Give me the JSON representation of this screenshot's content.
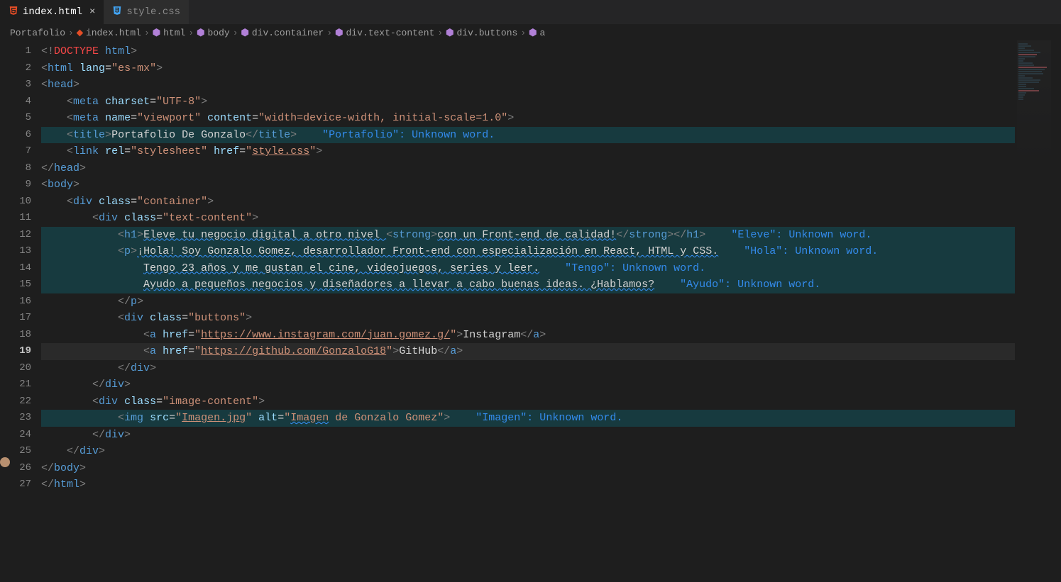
{
  "tabs": [
    {
      "name": "index.html",
      "active": true,
      "iconColor": "#e44d26"
    },
    {
      "name": "style.css",
      "active": false,
      "iconColor": "#42a5f5"
    }
  ],
  "breadcrumb": [
    {
      "text": "Portafolio",
      "icon": ""
    },
    {
      "text": "index.html",
      "icon": "html"
    },
    {
      "text": "html",
      "icon": "cube"
    },
    {
      "text": "body",
      "icon": "cube"
    },
    {
      "text": "div.container",
      "icon": "cube"
    },
    {
      "text": "div.text-content",
      "icon": "cube"
    },
    {
      "text": "div.buttons",
      "icon": "cube"
    },
    {
      "text": "a",
      "icon": "cube"
    }
  ],
  "lineCount": 27,
  "currentLine": 19,
  "highlightedLines": [
    6,
    12,
    13,
    14,
    15,
    23
  ],
  "hints": {
    "l6": "\"Portafolio\": Unknown word.",
    "l12": "\"Eleve\": Unknown word.",
    "l13": "\"Hola\": Unknown word.",
    "l14": "\"Tengo\": Unknown word.",
    "l15": "\"Ayudo\": Unknown word.",
    "l23": "\"Imagen\": Unknown word."
  },
  "code": {
    "l1": {
      "doctype": "DOCTYPE",
      "html": "html"
    },
    "l2": {
      "tag": "html",
      "attr": "lang",
      "val": "\"es-mx\""
    },
    "l3": {
      "tag": "head"
    },
    "l4": {
      "tag": "meta",
      "a1": "charset",
      "v1": "\"UTF-8\""
    },
    "l5": {
      "tag": "meta",
      "a1": "name",
      "v1": "\"viewport\"",
      "a2": "content",
      "v2": "\"width=device-width, initial-scale=1.0\""
    },
    "l6": {
      "tag": "title",
      "text": "Portafolio De Gonzalo"
    },
    "l7": {
      "tag": "link",
      "a1": "rel",
      "v1": "\"stylesheet\"",
      "a2": "href",
      "v2": "\"style.css\"",
      "linkText": "style.css"
    },
    "l8": {
      "tag": "head"
    },
    "l9": {
      "tag": "body"
    },
    "l10": {
      "tag": "div",
      "a1": "class",
      "v1": "\"container\""
    },
    "l11": {
      "tag": "div",
      "a1": "class",
      "v1": "\"text-content\""
    },
    "l12": {
      "tag": "h1",
      "t1": "Eleve tu negocio digital a otro nivel ",
      "strong": "strong",
      "t2": "con un Front-end de calidad!"
    },
    "l13": {
      "tag": "p",
      "t1": "¡Hola! Soy Gonzalo Gomez, desarrollador Front-end con especialización en React, HTML y CSS."
    },
    "l14": {
      "t1": "Tengo 23 años y me gustan el cine, videojuegos, series y leer."
    },
    "l15": {
      "t1": "Ayudo a pequeños negocios y diseñadores a llevar a cabo buenas ideas. ¿Hablamos?"
    },
    "l16": {
      "tag": "p"
    },
    "l17": {
      "tag": "div",
      "a1": "class",
      "v1": "\"buttons\""
    },
    "l18": {
      "tag": "a",
      "a1": "href",
      "v1": "\"https://www.instagram.com/juan.gomez.g/\"",
      "linkText": "https://www.instagram.com/juan.gomez.g/",
      "text": "Instagram"
    },
    "l19": {
      "tag": "a",
      "a1": "href",
      "v1": "\"https://github.com/GonzaloG18\"",
      "linkText": "https://github.com/GonzaloG18",
      "text": "GitHub"
    },
    "l20": {
      "tag": "div"
    },
    "l21": {
      "tag": "div"
    },
    "l22": {
      "tag": "div",
      "a1": "class",
      "v1": "\"image-content\""
    },
    "l23": {
      "tag": "img",
      "a1": "src",
      "v1": "\"Imagen.jpg\"",
      "linkText": "Imagen.jpg",
      "a2": "alt",
      "v2a": "Imagen",
      "v2b": " de Gonzalo Gomez"
    },
    "l24": {
      "tag": "div"
    },
    "l25": {
      "tag": "div"
    },
    "l26": {
      "tag": "body"
    },
    "l27": {
      "tag": "html"
    }
  }
}
